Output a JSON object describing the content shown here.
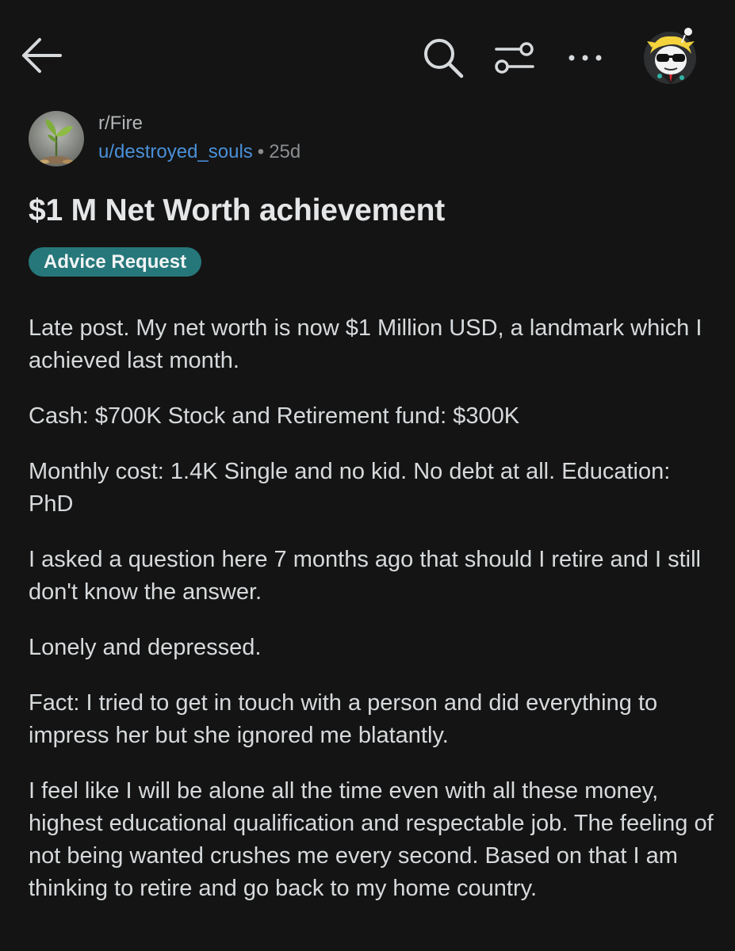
{
  "topbar": {
    "back_icon": "arrow-left-icon",
    "search_icon": "search-icon",
    "filter_icon": "sliders-icon",
    "more_icon": "more-horizontal-icon",
    "avatar_icon": "user-avatar"
  },
  "post": {
    "subreddit": "r/Fire",
    "author": "u/destroyed_souls",
    "separator": "•",
    "age": "25d",
    "title": "$1 M Net Worth achievement",
    "flair": "Advice Request",
    "paragraphs": [
      "Late post. My net worth is now $1 Million USD, a landmark which I achieved last month.",
      "Cash: $700K Stock and Retirement fund: $300K",
      "Monthly cost: 1.4K Single and no kid. No debt at all. Education: PhD",
      "I asked a question here 7 months ago that should I retire and I still don't know the answer.",
      "Lonely and depressed.",
      "Fact: I tried to get in touch with a person and did everything to impress her but she ignored me blatantly.",
      "I feel like I will be alone all the time even with all these money, highest educational qualification and respectable job. The feeling of not being wanted crushes me every second. Based on that I am thinking to retire and go back to my home country."
    ]
  },
  "colors": {
    "background": "#141414",
    "username": "#4a90d9",
    "flair_bg": "#26777a"
  }
}
